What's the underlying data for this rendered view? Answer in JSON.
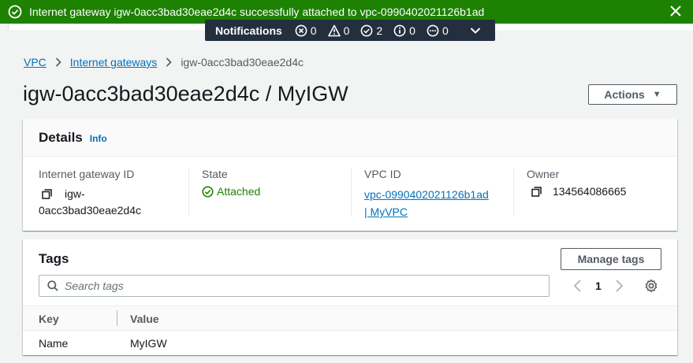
{
  "flash": {
    "message": "Internet gateway igw-0acc3bad30eae2d4c successfully attached to vpc-0990402021126b1ad",
    "color": "#1d8102"
  },
  "notifications": {
    "title": "Notifications",
    "error_count": "0",
    "warning_count": "0",
    "success_count": "2",
    "info_count": "0",
    "pending_count": "0"
  },
  "breadcrumb": {
    "items": [
      "VPC",
      "Internet gateways"
    ],
    "current": "igw-0acc3bad30eae2d4c"
  },
  "page": {
    "title": "igw-0acc3bad30eae2d4c / MyIGW",
    "actions_label": "Actions"
  },
  "details": {
    "title": "Details",
    "info_label": "Info",
    "igw_label": "Internet gateway ID",
    "igw_value_line1": "igw-",
    "igw_value_line2": "0acc3bad30eae2d4c",
    "state_label": "State",
    "state_value": "Attached",
    "vpc_label": "VPC ID",
    "vpc_value_line1": "vpc-0990402021126b1ad",
    "vpc_value_line2": "| MyVPC",
    "owner_label": "Owner",
    "owner_value": "134564086665"
  },
  "tags": {
    "title": "Tags",
    "manage_label": "Manage tags",
    "search_placeholder": "Search tags",
    "page": "1",
    "columns": [
      "Key",
      "Value"
    ],
    "rows": [
      {
        "key": "Name",
        "value": "MyIGW"
      }
    ]
  },
  "colors": {
    "link": "#0073bb",
    "success": "#1d8102",
    "dark_bar": "#232f3e"
  }
}
